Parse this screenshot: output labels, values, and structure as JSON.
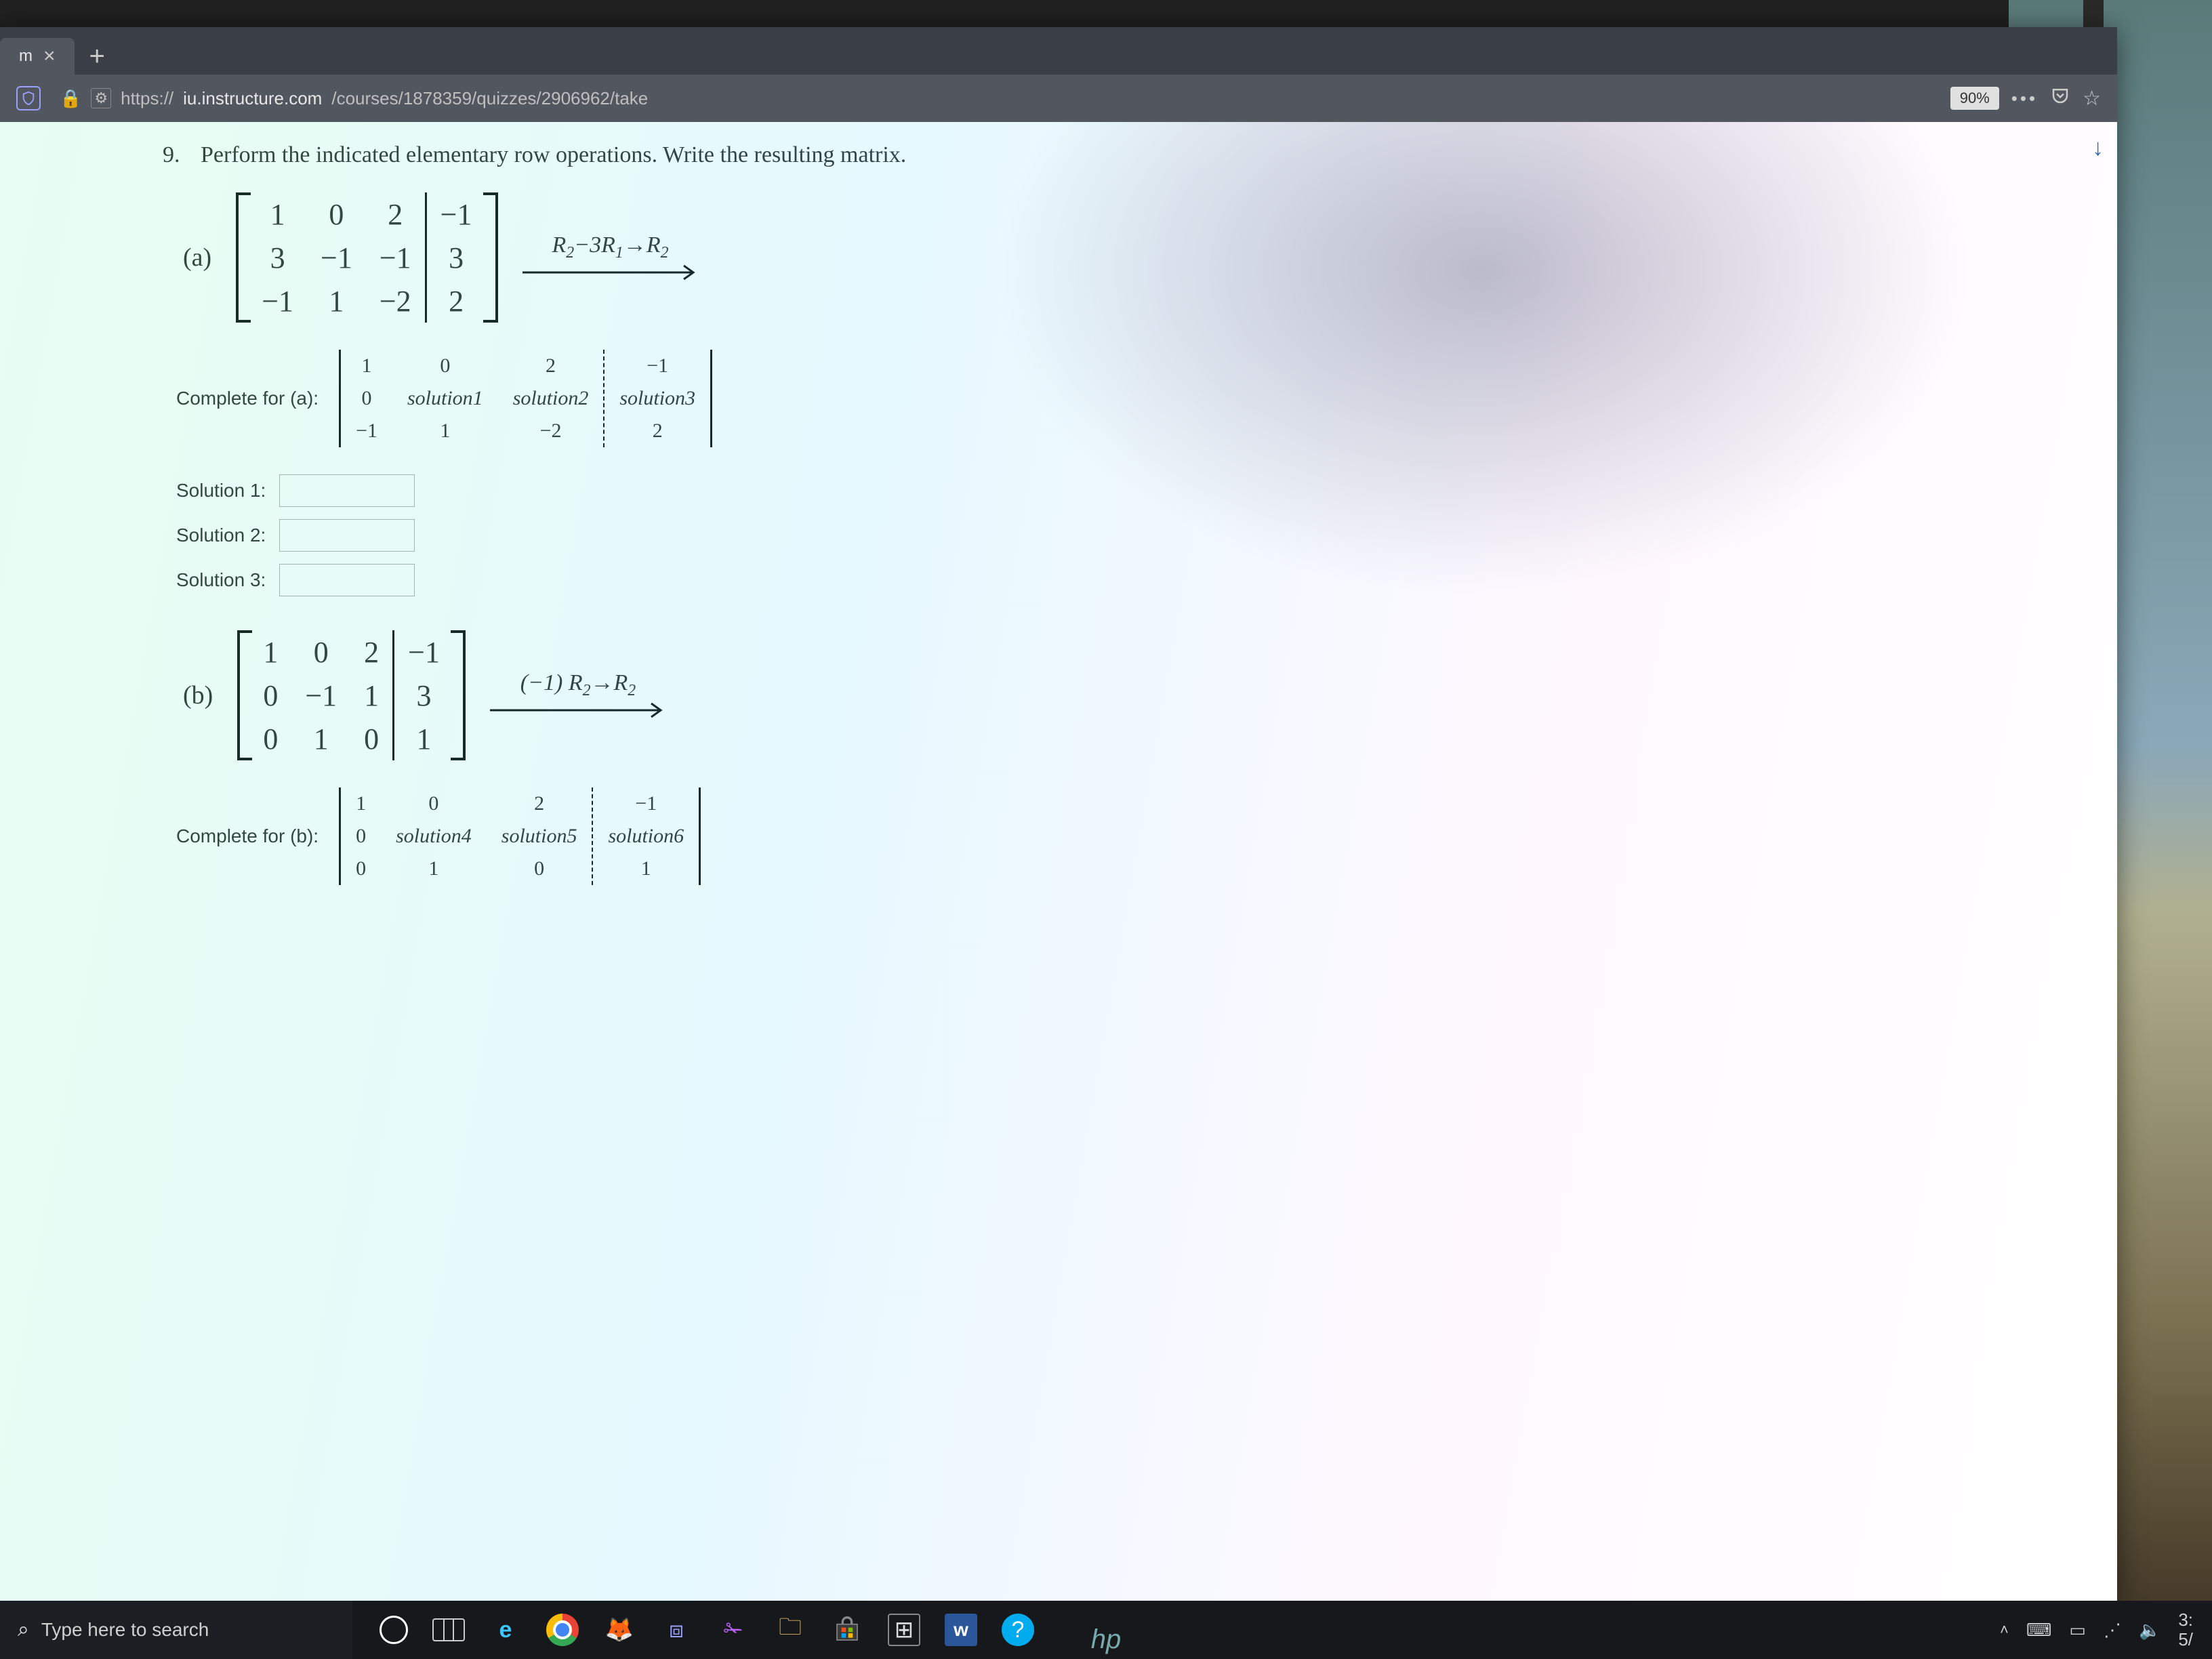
{
  "browser": {
    "tab_title": "m",
    "url_host": "iu.instructure.com",
    "url_path": "/courses/1878359/quizzes/2906962/take",
    "url_scheme": "https://",
    "zoom": "90%"
  },
  "question": {
    "number": "9.",
    "text": "Perform the indicated elementary row operations. Write the resulting matrix."
  },
  "part_a": {
    "label": "(a)",
    "matrix": {
      "r1": [
        "1",
        "0",
        "2",
        "−1"
      ],
      "r2": [
        "3",
        "−1",
        "−1",
        "3"
      ],
      "r3": [
        "−1",
        "1",
        "−2",
        "2"
      ]
    },
    "op": "R₂−3R₁→R₂",
    "complete_label": "Complete for (a):",
    "complete_matrix": {
      "r1": [
        "1",
        "0",
        "2",
        "−1"
      ],
      "r2": [
        "0",
        "solution1",
        "solution2",
        "solution3"
      ],
      "r3": [
        "−1",
        "1",
        "−2",
        "2"
      ]
    },
    "inputs": {
      "s1_label": "Solution 1:",
      "s2_label": "Solution 2:",
      "s3_label": "Solution 3:"
    }
  },
  "part_b": {
    "label": "(b)",
    "matrix": {
      "r1": [
        "1",
        "0",
        "2",
        "−1"
      ],
      "r2": [
        "0",
        "−1",
        "1",
        "3"
      ],
      "r3": [
        "0",
        "1",
        "0",
        "1"
      ]
    },
    "op": "(−1) R₂→R₂",
    "complete_label": "Complete for (b):",
    "complete_matrix": {
      "r1": [
        "1",
        "0",
        "2",
        "−1"
      ],
      "r2": [
        "0",
        "solution4",
        "solution5",
        "solution6"
      ],
      "r3": [
        "0",
        "1",
        "0",
        "1"
      ]
    }
  },
  "taskbar": {
    "search_placeholder": "Type here to search",
    "word_letter": "w",
    "help_symbol": "?",
    "time_partial": "3:",
    "date_partial": "5/"
  },
  "laptop_brand": "hp"
}
